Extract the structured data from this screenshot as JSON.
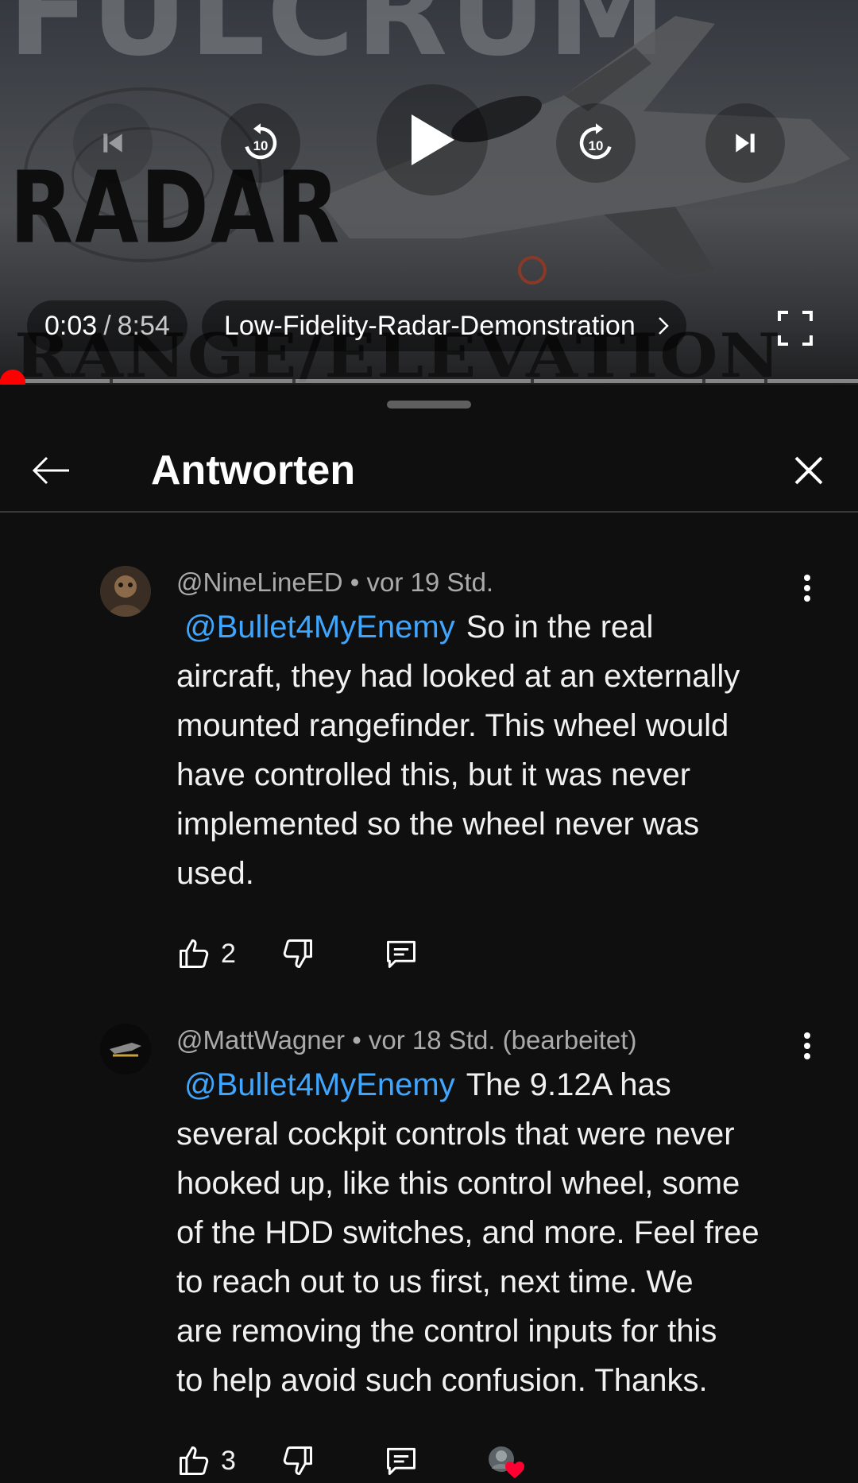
{
  "player": {
    "thumbnail_text": {
      "top": "FULCRUM",
      "middle": "RADAR",
      "bottom": "RANGE/ELEVATION"
    },
    "current_time": "0:03",
    "time_separator": "/",
    "duration": "8:54",
    "chapter": "Low-Fidelity-Radar-Demonstration",
    "progress_fraction": 0.006,
    "icons": {
      "previous": "skip-previous-icon",
      "rewind": "rewind-10-icon",
      "play": "play-icon",
      "forward": "forward-10-icon",
      "next": "skip-next-icon",
      "chapter": "chevron-right-icon",
      "fullscreen": "fullscreen-icon"
    }
  },
  "panel": {
    "title": "Antworten"
  },
  "comments": [
    {
      "author": "@NineLineED",
      "time": "vor 19 Std.",
      "mention": "@Bullet4MyEnemy",
      "lines": [
        "So in the real",
        "aircraft, they had looked at an externally",
        "mounted rangefinder. This wheel would",
        "have controlled this, but it was never",
        "implemented so the wheel never was",
        "used."
      ],
      "likes": "2"
    },
    {
      "author": "@MattWagner",
      "time": "vor 18 Std. (bearbeitet)",
      "mention": "@Bullet4MyEnemy",
      "lines": [
        "The 9.12A has",
        "several cockpit controls that were never",
        "hooked up, like this control wheel, some",
        "of the HDD switches, and more. Feel free",
        "to reach out to us first, next time.  We",
        "are removing the control inputs for this",
        "to help avoid such confusion. Thanks."
      ],
      "likes": "3",
      "creator_heart": true
    }
  ],
  "colors": {
    "background": "#0f0f0f",
    "mention": "#3ea6ff",
    "progress": "#ff0000",
    "secondary_text": "#aaaaaa"
  },
  "dot": "•"
}
